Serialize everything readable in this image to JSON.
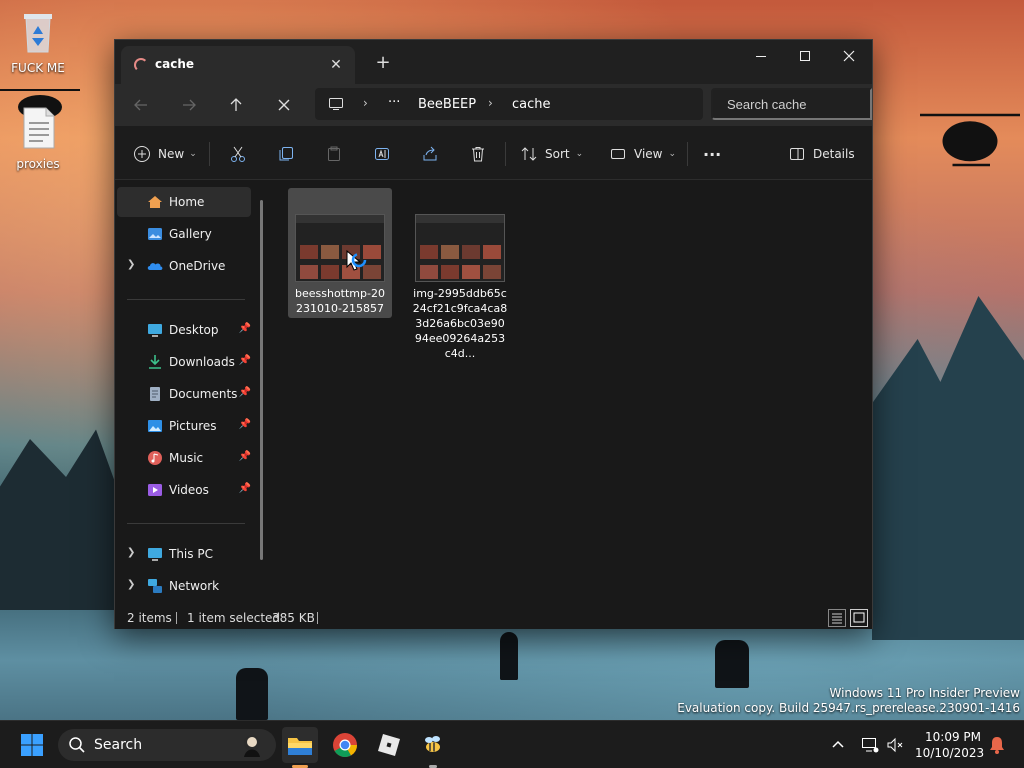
{
  "desktop": {
    "icons": [
      {
        "label": "FUCK ME"
      },
      {
        "label": "proxies"
      }
    ]
  },
  "window": {
    "tab_title": "cache",
    "new_tab_symbol": "+",
    "close_tab_symbol": "✕"
  },
  "address": {
    "segments": [
      "BeeBEEP",
      "cache"
    ],
    "overflow": "···"
  },
  "search": {
    "placeholder": "Search cache"
  },
  "toolbar": {
    "new_label": "New",
    "sort_label": "Sort",
    "view_label": "View",
    "more_label": "···",
    "details_label": "Details"
  },
  "sidebar": {
    "items": [
      {
        "label": "Home"
      },
      {
        "label": "Gallery"
      },
      {
        "label": "OneDrive"
      },
      {
        "label": "Desktop"
      },
      {
        "label": "Downloads"
      },
      {
        "label": "Documents"
      },
      {
        "label": "Pictures"
      },
      {
        "label": "Music"
      },
      {
        "label": "Videos"
      },
      {
        "label": "This PC"
      },
      {
        "label": "Network"
      }
    ]
  },
  "files": [
    {
      "name": "beesshottmp-20231010-215857"
    },
    {
      "name": "img-2995ddb65c24cf21c9fca4ca83d26a6bc03e9094ee09264a253c4d..."
    }
  ],
  "status": {
    "count": "2 items",
    "selected": "1 item selected",
    "size": "385 KB"
  },
  "watermark": {
    "line1": "Windows 11 Pro Insider Preview",
    "line2": "Evaluation copy. Build 25947.rs_prerelease.230901-1416"
  },
  "taskbar": {
    "search_label": "Search",
    "time": "10:09 PM",
    "date": "10/10/2023"
  },
  "colors": {
    "accent": "#0078d4",
    "folder_yellow": "#f6c445",
    "chrome_red": "#db4437",
    "chrome_green": "#0f9d58",
    "chrome_yellow": "#f4b400"
  }
}
